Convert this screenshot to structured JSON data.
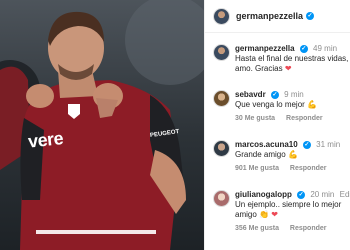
{
  "post": {
    "author": "germanpezzella",
    "shirt_text": "vere",
    "shirt_sponsor": "PEUGEOT"
  },
  "comments": [
    {
      "user": "germanpezzella",
      "time": "49 min",
      "text": "Hasta el final de nuestras vidas, amo. Gracias",
      "emoji": "❤",
      "likes": "",
      "reply": ""
    },
    {
      "user": "sebavdr",
      "time": "9 min",
      "text": "Que venga lo mejor",
      "emoji": "💪",
      "likes": "30 Me gusta",
      "reply": "Responder"
    },
    {
      "user": "marcos.acuna10",
      "time": "31 min",
      "text": "Grande amigo",
      "emoji": "💪",
      "likes": "901 Me gusta",
      "reply": "Responder"
    },
    {
      "user": "giulianogalopp",
      "time": "20 min",
      "edited": "Editado",
      "text": "Un ejemplo.. siempre lo mejor amigo",
      "emoji": "👏 ❤",
      "likes": "356 Me gusta",
      "reply": "Responder"
    }
  ],
  "icons": {
    "verified": "verified-badge-icon",
    "heart": "heart-icon"
  },
  "colors": {
    "verified": "#0095f6",
    "heart": "#ed4956",
    "muted": "#8e8e8e"
  }
}
